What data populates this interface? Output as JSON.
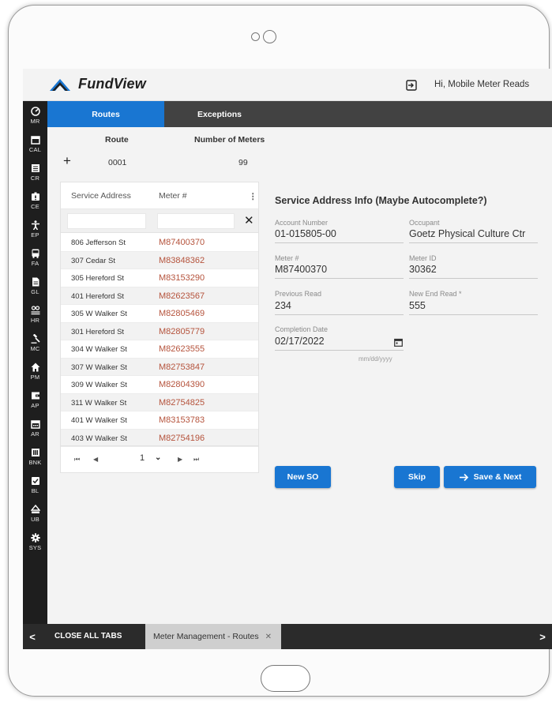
{
  "app": {
    "logo_text": "FundView",
    "greeting": "Hi, Mobile Meter Reads"
  },
  "sidebar": {
    "items": [
      {
        "label": "MR",
        "icon": "meter-icon"
      },
      {
        "label": "CAL",
        "icon": "calendar-icon"
      },
      {
        "label": "CR",
        "icon": "list-icon"
      },
      {
        "label": "CE",
        "icon": "badge-icon"
      },
      {
        "label": "EP",
        "icon": "person-icon"
      },
      {
        "label": "FA",
        "icon": "bus-icon"
      },
      {
        "label": "GL",
        "icon": "document-icon"
      },
      {
        "label": "HR",
        "icon": "people-icon"
      },
      {
        "label": "MC",
        "icon": "gavel-icon"
      },
      {
        "label": "PM",
        "icon": "home-icon"
      },
      {
        "label": "AP",
        "icon": "wallet-icon"
      },
      {
        "label": "AR",
        "icon": "calendar-icon"
      },
      {
        "label": "BNK",
        "icon": "bank-icon"
      },
      {
        "label": "BL",
        "icon": "checkbox-icon"
      },
      {
        "label": "UB",
        "icon": "drop-icon"
      },
      {
        "label": "SYS",
        "icon": "gear-icon"
      }
    ]
  },
  "tabs": [
    {
      "label": "Routes"
    },
    {
      "label": "Exceptions"
    }
  ],
  "route": {
    "route_header": "Route",
    "meters_header": "Number of Meters",
    "route_value": "0001",
    "meters_value": "99"
  },
  "grid": {
    "headers": {
      "address": "Service Address",
      "meter": "Meter #"
    },
    "rows": [
      {
        "address": "806 Jefferson St",
        "meter": "M87400370"
      },
      {
        "address": "307 Cedar St",
        "meter": "M83848362"
      },
      {
        "address": "305 Hereford St",
        "meter": "M83153290"
      },
      {
        "address": "401 Hereford St",
        "meter": "M82623567"
      },
      {
        "address": "305 W Walker St",
        "meter": "M82805469"
      },
      {
        "address": "301 Hereford St",
        "meter": "M82805779"
      },
      {
        "address": "304 W Walker St",
        "meter": "M82623555"
      },
      {
        "address": "307 W Walker St",
        "meter": "M82753847"
      },
      {
        "address": "309 W Walker St",
        "meter": "M82804390"
      },
      {
        "address": "311 W Walker St",
        "meter": "M82754825"
      },
      {
        "address": "401 W Walker St",
        "meter": "M83153783"
      },
      {
        "address": "403 W Walker St",
        "meter": "M82754196"
      }
    ],
    "pager": {
      "first": "⏮",
      "prev": "◀",
      "page": "1",
      "next": "▶",
      "last": "⏭"
    }
  },
  "info": {
    "title": "Service Address Info (Maybe Autocomplete?)",
    "account_label": "Account Number",
    "account_value": "01-015805-00",
    "occupant_label": "Occupant",
    "occupant_value": "Goetz Physical Culture Ctr",
    "meter_label": "Meter #",
    "meter_value": "M87400370",
    "meter_id_label": "Meter ID",
    "meter_id_value": "30362",
    "prev_read_label": "Previous Read",
    "prev_read_value": "234",
    "new_read_label": "New End Read *",
    "new_read_value": "555",
    "completion_label": "Completion Date",
    "completion_value": "02/17/2022",
    "date_hint": "mm/dd/yyyy"
  },
  "buttons": {
    "new_so": "New SO",
    "skip": "Skip",
    "save_next": "Save & Next"
  },
  "bottom_bar": {
    "close_all": "CLOSE ALL TABS",
    "open_tab": "Meter Management - Routes"
  },
  "colors": {
    "accent": "#1976d2",
    "meter_text": "#b5533c",
    "sidebar": "#1e1e1e",
    "tabbar": "#424242"
  }
}
